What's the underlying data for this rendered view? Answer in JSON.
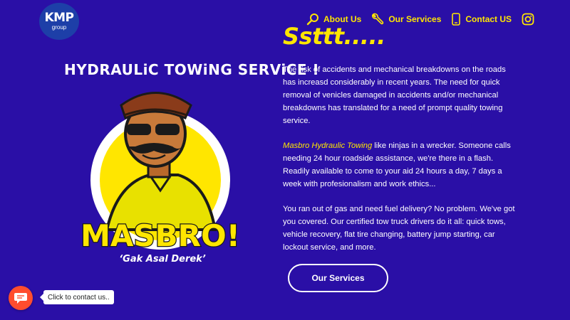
{
  "logo": {
    "line1": "KMP",
    "line2": "group"
  },
  "nav": {
    "items": [
      {
        "label": "About Us",
        "icon": "search-icon"
      },
      {
        "label": "Our Services",
        "icon": "wrench-icon"
      },
      {
        "label": "Contact US",
        "icon": "phone-icon"
      }
    ],
    "instagram_icon": "instagram-icon"
  },
  "hero": {
    "title": "HYDRAULiC TOWiNG SERViCE !"
  },
  "mascot": {
    "brand": "MASBRO!",
    "tagline": "‘Gak Asal Derek’"
  },
  "content": {
    "headline": "Ssttt.....",
    "p1": "The risk of accidents and mechanical breakdowns on the roads has increasd considerably in recent years. The need for quick removal of venicles damaged in accidents and/or mechanical breakdowns has translated for a need of prompt quality towing service.",
    "p2_highlight": "Masbro Hydraulic Towing",
    "p2_rest": " like ninjas in a wrecker. Someone calls needing 24 hour roadside assistance, we're there in a flash. Readily available to come to your aid 24 hours a day, 7 days a week with profesionalism and work ethics...",
    "p3": "You ran out of gas and need fuel delivery? No problem. We've got you covered. Our certified tow truck drivers do it all: quick tows, vehicle recovery, flat tire changing, battery jump starting, car lockout service, and more.",
    "cta": "Our Services"
  },
  "chat": {
    "tooltip": "Click to contact us..",
    "icon": "chat-icon"
  },
  "colors": {
    "background": "#2a0fa6",
    "accent": "#ffe600",
    "chat": "#ff4d2e"
  }
}
